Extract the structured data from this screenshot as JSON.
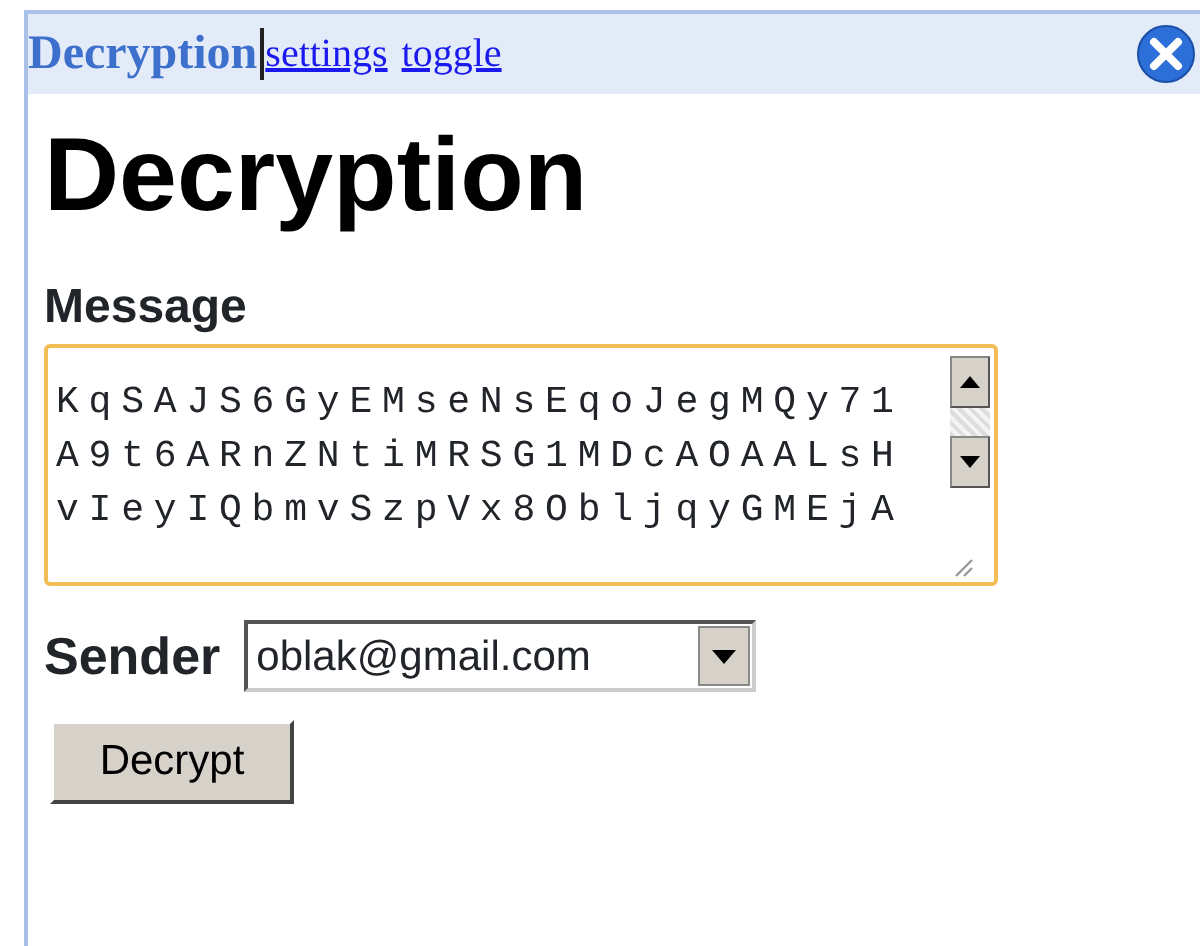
{
  "header": {
    "title": "Decryption",
    "links": [
      "settings",
      "toggle"
    ]
  },
  "heading": "Decryption",
  "message": {
    "label": "Message",
    "lines": [
      "KqSAJS6GyEMseNsEqoJegMQy71",
      "A9t6ARnZNtiMRSG1MDcAOAALsH",
      "vIeyIQbmvSzpVx8ObljqyGMEjA"
    ]
  },
  "sender": {
    "label": "Sender",
    "value": "oblak@gmail.com"
  },
  "button": "Decrypt"
}
